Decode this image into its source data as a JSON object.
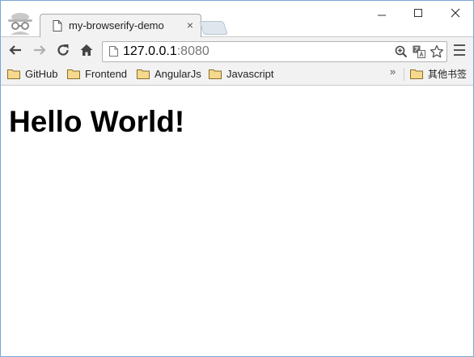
{
  "tab": {
    "title": "my-browserify-demo",
    "close_label": "×"
  },
  "address_bar": {
    "host": "127.0.0.1",
    "port": ":8080"
  },
  "bookmarks": {
    "items": [
      {
        "label": "GitHub"
      },
      {
        "label": "Frontend"
      },
      {
        "label": "AngularJs"
      },
      {
        "label": "Javascript"
      }
    ],
    "overflow_label": "»",
    "other_label": "其他书签"
  },
  "page": {
    "heading": "Hello World!"
  },
  "icons": {
    "incognito": "incognito-icon",
    "back": "back-arrow-icon",
    "forward": "forward-arrow-icon",
    "reload": "reload-icon",
    "home": "home-icon",
    "zoom": "zoom-icon",
    "translate": "translate-icon",
    "star": "star-icon",
    "menu": "hamburger-menu-icon",
    "folder": "folder-icon"
  },
  "colors": {
    "folder": "#f2cd7a",
    "frame_border": "#7aa7d6",
    "toolbar": "#f2f2f2"
  }
}
